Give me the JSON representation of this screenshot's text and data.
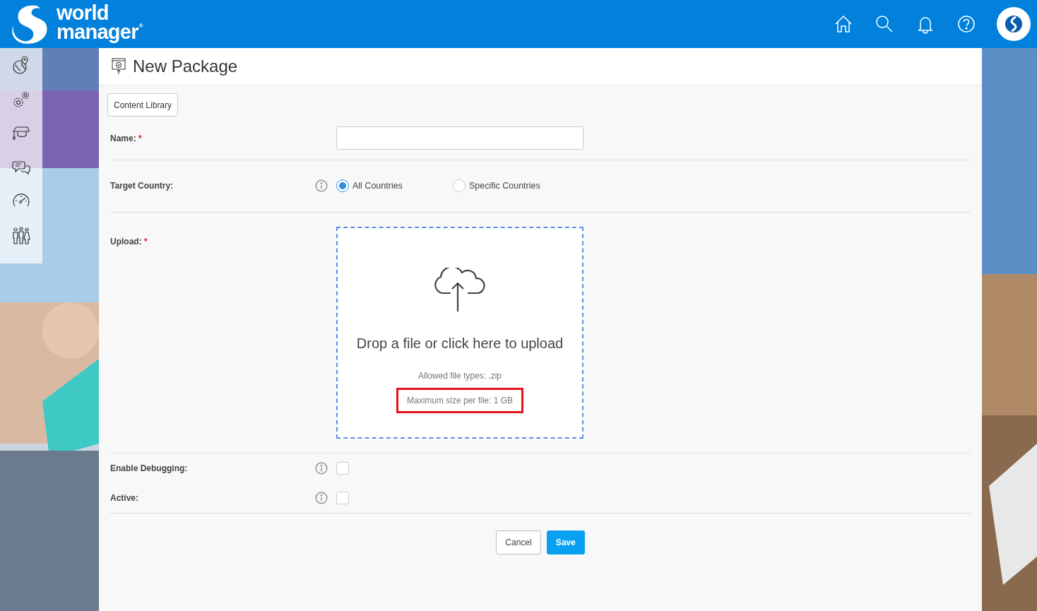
{
  "header": {
    "logo": {
      "line1": "world",
      "line2": "manager",
      "mark": "®"
    }
  },
  "page": {
    "title": "New Package",
    "toolbar_button": "Content Library"
  },
  "form": {
    "rows": [
      {
        "kind": "text",
        "label": "Name:",
        "required_mark": "*",
        "info": false,
        "value": "",
        "divider_after": true
      },
      {
        "kind": "radio",
        "label": "Target Country:",
        "info": true,
        "divider_after": true,
        "options": [
          {
            "label": "All Countries",
            "selected": true
          },
          {
            "label": "Specific Countries",
            "selected": false
          }
        ]
      },
      {
        "kind": "upload",
        "label": "Upload:",
        "required_mark": "*",
        "info": false,
        "divider_after": true,
        "prompt": "Drop a file or click here to upload",
        "notes": [
          {
            "text": "Allowed file types: .zip",
            "highlighted": false
          },
          {
            "text": "Maximum size per file: 1 GB",
            "highlighted": true
          }
        ]
      },
      {
        "kind": "checkbox",
        "label": "Enable Debugging:",
        "info": true,
        "checked": false,
        "divider_after": false
      },
      {
        "kind": "checkbox",
        "label": "Active:",
        "info": true,
        "checked": false,
        "divider_after": true
      }
    ]
  },
  "buttons": [
    {
      "label": "Cancel",
      "kind": "secondary"
    },
    {
      "label": "Save",
      "kind": "primary"
    }
  ]
}
